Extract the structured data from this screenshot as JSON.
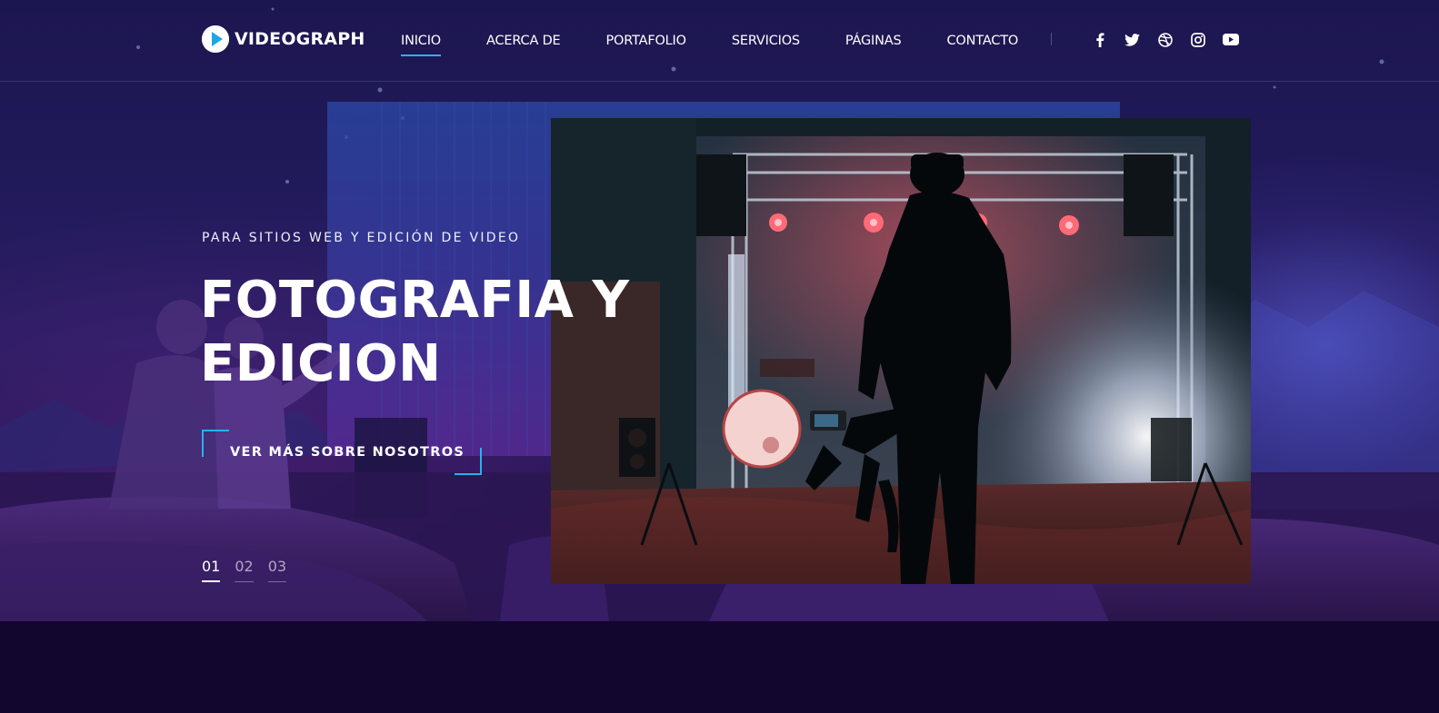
{
  "brand": {
    "name": "VIDEOGRAPH",
    "logo_icon": "play-icon",
    "accent": "#28b2ec"
  },
  "nav": {
    "items": [
      {
        "label": "INICIO",
        "active": true
      },
      {
        "label": "ACERCA DE",
        "active": false
      },
      {
        "label": "PORTAFOLIO",
        "active": false
      },
      {
        "label": "SERVICIOS",
        "active": false
      },
      {
        "label": "PÁGINAS",
        "active": false
      },
      {
        "label": "CONTACTO",
        "active": false
      }
    ]
  },
  "social": [
    "facebook-icon",
    "twitter-icon",
    "dribbble-icon",
    "instagram-icon",
    "youtube-icon"
  ],
  "hero": {
    "eyebrow": "PARA SITIOS WEB Y EDICIÓN DE VIDEO",
    "headline_line1": "FOTOGRAFIA Y",
    "headline_line2": "EDICION",
    "cta_label": "VER MÁS SOBRE NOSOTROS",
    "slides": [
      "01",
      "02",
      "03"
    ],
    "active_slide": "01"
  },
  "colors": {
    "background": "#12062e",
    "hero_top": "#1c1650",
    "hero_bottom": "#241045"
  }
}
